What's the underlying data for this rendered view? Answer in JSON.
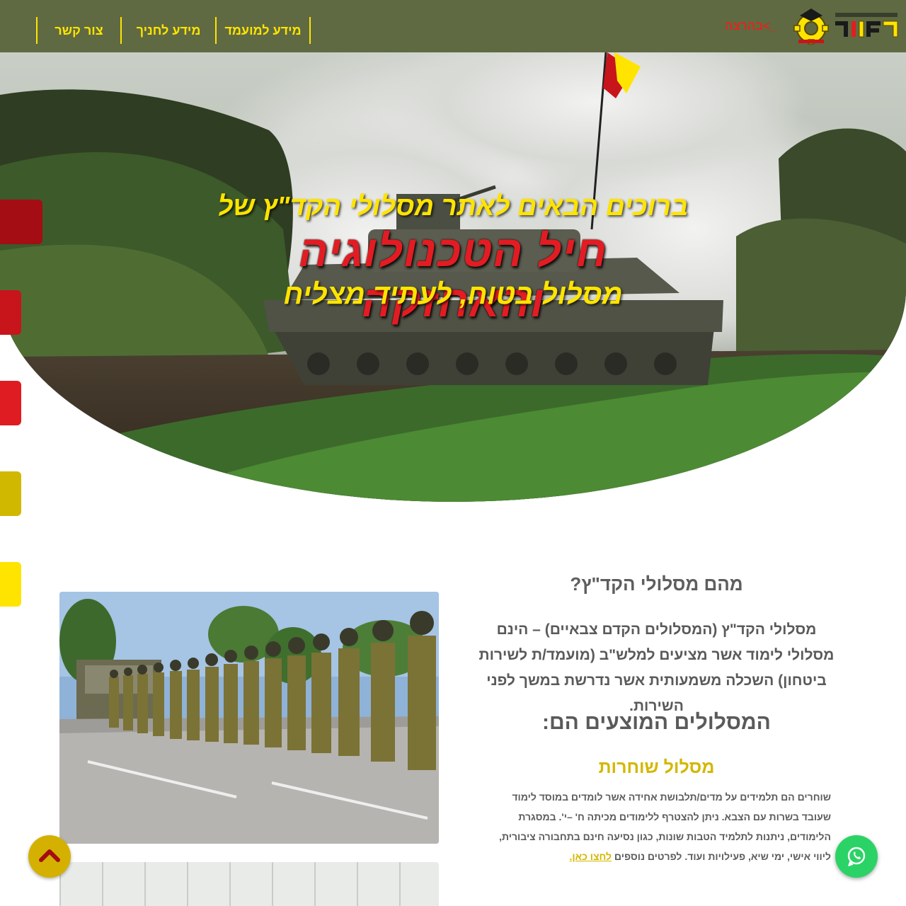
{
  "header": {
    "nav": [
      {
        "label": "צור קשר"
      },
      {
        "label": "מידע לחניך"
      },
      {
        "label": "מידע למועמד"
      }
    ],
    "brand_name": "מסלולי הקד\"ץ",
    "back_link": "בהרצה<_"
  },
  "hero": {
    "line1": "ברוכים הבאים לאתר מסלולי הקד\"ץ של",
    "line2": "חיל הטכנולוגיה והאחזקה",
    "line3": "מסלול בטוח, לעתיד מצליח"
  },
  "main": {
    "question_title": "מהם מסלולי הקד\"ץ?",
    "intro": "מסלולי הקד\"ץ (המסלולים הקדם צבאיים) – הינם מסלולי לימוד אשר מציעים למלש\"ב (מועמד/ת לשירות ביטחון) השכלה משמעותית אשר נדרשת במשך לפני השירות.",
    "tracks_title": "המסלולים המוצעים הם:",
    "track": {
      "title": "מסלול שוחרות",
      "description": "שוחרים הם תלמידים על מדים/תלבושת אחידה אשר לומדים במוסד לימוד שעובד בשרות עם הצבא. ניתן להצטרף ללימודים מכיתה ח' –י'. במסגרת הלימודים, ניתנות לתלמיד הטבות שונות, כגון נסיעה חינם בתחבורה ציבורית, ליווי אישי, ימי שיא, פעילויות ועוד. לפרטים נוספים",
      "more_link": "לחצו כאן."
    }
  },
  "side_tabs": [
    "#a30d13",
    "#c8141b",
    "#e01c23",
    "#d1b800",
    "#ffe400"
  ],
  "buttons": {
    "scroll_top_icon": "chevron-up-icon",
    "whatsapp_icon": "whatsapp-icon"
  },
  "colors": {
    "header_bg": "#5f6a43",
    "accent_yellow": "#ffe400",
    "accent_red": "#e31c23",
    "whatsapp_green": "#2bd366"
  }
}
